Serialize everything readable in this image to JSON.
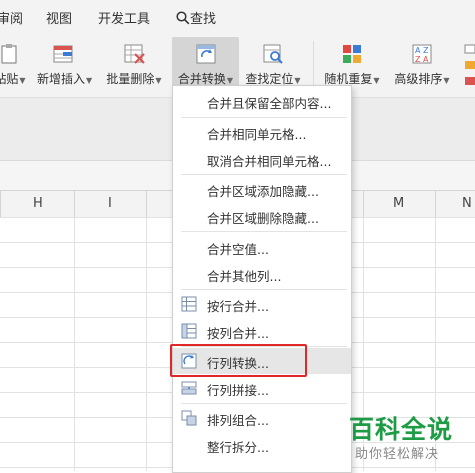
{
  "menubar": {
    "items": [
      "审阅",
      "视图",
      "开发工具"
    ],
    "search_label": "查找"
  },
  "ribbon": {
    "buttons": [
      {
        "label": "粘贴",
        "icon": "paste-icon",
        "has_caret": true
      },
      {
        "label": "新增插入",
        "icon": "insert-icon",
        "has_caret": true
      },
      {
        "label": "批量删除",
        "icon": "batch-delete-icon",
        "has_caret": true
      },
      {
        "label": "合并转换",
        "icon": "merge-convert-icon",
        "has_caret": true,
        "active": true
      },
      {
        "label": "查找定位",
        "icon": "find-locate-icon",
        "has_caret": true
      },
      {
        "label": "随机重复",
        "icon": "random-repeat-icon",
        "has_caret": true
      },
      {
        "label": "高级排序",
        "icon": "advanced-sort-icon",
        "has_caret": true
      }
    ]
  },
  "columns": [
    "H",
    "I",
    "M",
    "N"
  ],
  "dropdown": {
    "groups": [
      [
        {
          "label": "合并且保留全部内容...",
          "icon": null
        }
      ],
      [
        {
          "label": "合并相同单元格...",
          "icon": null
        },
        {
          "label": "取消合并相同单元格...",
          "icon": null
        }
      ],
      [
        {
          "label": "合并区域添加隐藏...",
          "icon": null
        },
        {
          "label": "合并区域删除隐藏...",
          "icon": null
        }
      ],
      [
        {
          "label": "合并空值...",
          "icon": null
        },
        {
          "label": "合并其他列...",
          "icon": null
        }
      ],
      [
        {
          "label": "按行合并...",
          "icon": "merge-by-row-icon"
        },
        {
          "label": "按列合并...",
          "icon": "merge-by-column-icon"
        }
      ],
      [
        {
          "label": "行列转换...",
          "icon": "transpose-icon",
          "highlighted": true
        },
        {
          "label": "行列拼接...",
          "icon": "row-col-join-icon"
        }
      ],
      [
        {
          "label": "排列组合...",
          "icon": "permutation-icon"
        },
        {
          "label": "整行拆分...",
          "icon": null
        }
      ]
    ]
  },
  "watermark": {
    "title": "百科全说",
    "subtitle": "助你轻松解决"
  },
  "colors": {
    "highlight_border": "#e0282b",
    "watermark_green": "#1e9b45"
  }
}
